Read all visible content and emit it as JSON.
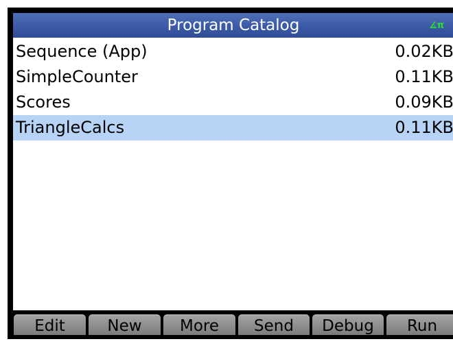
{
  "header": {
    "title": "Program Catalog",
    "angle_mode_indicator": "∡π"
  },
  "programs": [
    {
      "name": "Sequence (App)",
      "size": "0.02KB",
      "selected": false
    },
    {
      "name": "SimpleCounter",
      "size": "0.11KB",
      "selected": false
    },
    {
      "name": "Scores",
      "size": "0.09KB",
      "selected": false
    },
    {
      "name": "TriangleCalcs",
      "size": "0.11KB",
      "selected": true
    }
  ],
  "menu": {
    "softkeys": [
      "Edit",
      "New",
      "More",
      "Send",
      "Debug",
      "Run"
    ]
  },
  "colors": {
    "title_bar": "#3a58a3",
    "selection": "#b7d3f5",
    "indicator": "#2ee02e",
    "softkey": "#8c8c8c"
  }
}
